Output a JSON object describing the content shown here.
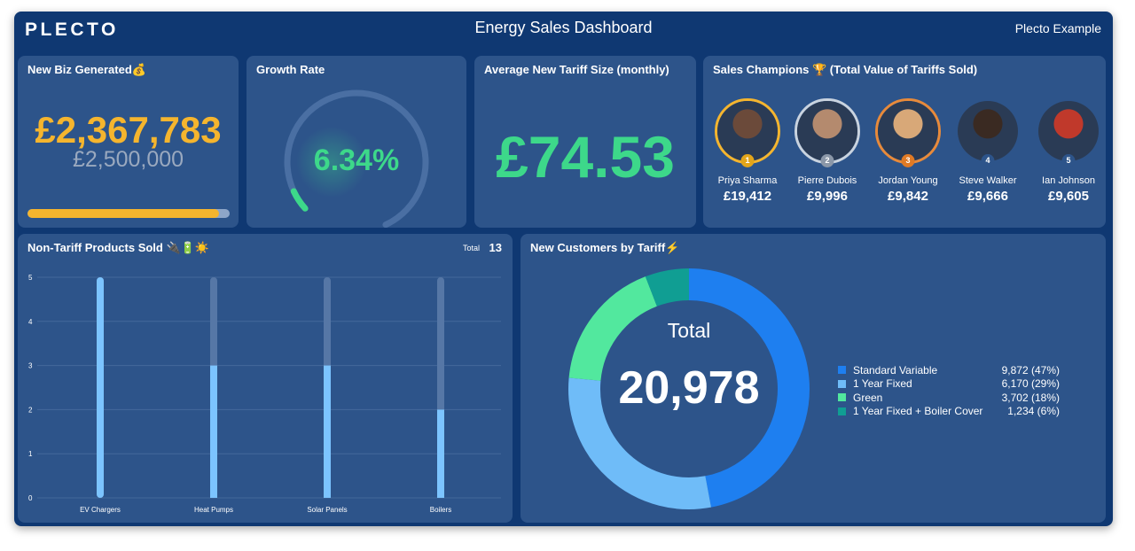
{
  "header": {
    "logo": "PLECTO",
    "title": "Energy Sales Dashboard",
    "account": "Plecto Example"
  },
  "new_biz": {
    "title": "New Biz Generated💰",
    "value": "£2,367,783",
    "target": "£2,500,000",
    "progress": 0.947,
    "color": "#f5b52e"
  },
  "growth": {
    "title": "Growth Rate",
    "value": "6.34%",
    "gauge_fraction": 0.0634,
    "color": "#3dd88a"
  },
  "avg_tariff": {
    "title": "Average New Tariff Size (monthly)",
    "value": "£74.53"
  },
  "champions": {
    "title": "Sales Champions 🏆 (Total Value of Tariffs Sold)",
    "people": [
      {
        "rank": "1",
        "name": "Priya Sharma",
        "value": "£19,412",
        "ring": "#f5b52e",
        "badge": "#e3a51a"
      },
      {
        "rank": "2",
        "name": "Pierre Dubois",
        "value": "£9,996",
        "ring": "#c9d3df",
        "badge": "#8b97a8"
      },
      {
        "rank": "3",
        "name": "Jordan Young",
        "value": "£9,842",
        "ring": "#e88a3a",
        "badge": "#e07a25"
      },
      {
        "rank": "4",
        "name": "Steve Walker",
        "value": "£9,666",
        "ring": "transparent",
        "badge": "#2d548a"
      },
      {
        "rank": "5",
        "name": "Ian Johnson",
        "value": "£9,605",
        "ring": "transparent",
        "badge": "#2d548a"
      }
    ]
  },
  "products": {
    "title": "Non-Tariff Products Sold 🔌🔋☀️",
    "total_label": "Total",
    "total_value": "13"
  },
  "customers": {
    "title": "New Customers by Tariff⚡",
    "center_label": "Total",
    "center_value": "20,978",
    "legend": [
      {
        "name": "Standard Variable",
        "value": "9,872 (47%)",
        "color": "#1e7ff0"
      },
      {
        "name": "1 Year Fixed",
        "value": "6,170 (29%)",
        "color": "#6fbcf8"
      },
      {
        "name": "Green",
        "value": "3,702 (18%)",
        "color": "#52e89e"
      },
      {
        "name": "1 Year Fixed + Boiler Cover",
        "value": "1,234 (6%)",
        "color": "#109e93"
      }
    ]
  },
  "chart_data": [
    {
      "type": "bar",
      "categories": [
        "EV Chargers",
        "Heat Pumps",
        "Solar Panels",
        "Boilers"
      ],
      "values": [
        5,
        3,
        3,
        2
      ],
      "yticks": [
        "0",
        "1",
        "2",
        "3",
        "4",
        "5"
      ],
      "ylim": [
        0,
        5
      ],
      "color": "#7cc4ff",
      "track_color": "#5677a6"
    },
    {
      "type": "pie",
      "donut": true,
      "categories": [
        "Standard Variable",
        "1 Year Fixed",
        "Green",
        "1 Year Fixed + Boiler Cover"
      ],
      "values": [
        9872,
        6170,
        3702,
        1234
      ],
      "colors": [
        "#1e7ff0",
        "#6fbcf8",
        "#52e89e",
        "#109e93"
      ]
    }
  ]
}
